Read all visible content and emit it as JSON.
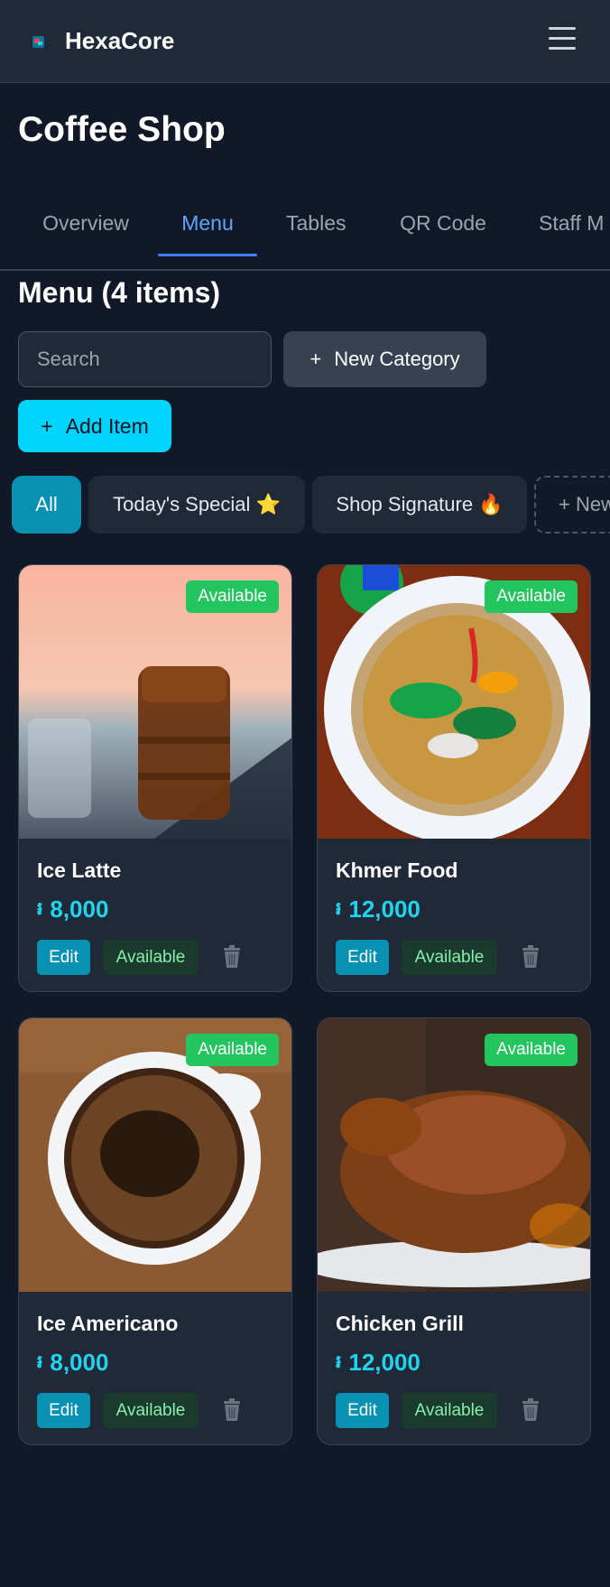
{
  "app": {
    "brand": "HexaCore",
    "logo_icon": "hexacore-logo-icon",
    "menu_icon": "hamburger-menu-icon"
  },
  "shop": {
    "title": "Coffee Shop"
  },
  "tabs": [
    {
      "label": "Overview",
      "active": false
    },
    {
      "label": "Menu",
      "active": true
    },
    {
      "label": "Tables",
      "active": false
    },
    {
      "label": "QR Code",
      "active": false
    },
    {
      "label": "Staff M",
      "active": false
    }
  ],
  "menu": {
    "heading": "Menu (4 items)",
    "search_placeholder": "Search",
    "new_category_label": "New Category",
    "add_item_label": "Add Item",
    "plus_glyph": "+"
  },
  "categories": [
    {
      "label": "All",
      "active": true
    },
    {
      "label": "Today's Special ⭐",
      "active": false
    },
    {
      "label": "Shop Signature 🔥",
      "active": false
    },
    {
      "label": "+ New",
      "active": false
    }
  ],
  "items": [
    {
      "name": "Ice Latte",
      "currency": "៛",
      "price": "8,000",
      "badge": "Available",
      "edit_label": "Edit",
      "status_label": "Available",
      "image": "iced-coffee-glass"
    },
    {
      "name": "Khmer Food",
      "currency": "៛",
      "price": "12,000",
      "badge": "Available",
      "edit_label": "Edit",
      "status_label": "Available",
      "image": "soup-bowl"
    },
    {
      "name": "Ice Americano",
      "currency": "៛",
      "price": "8,000",
      "badge": "Available",
      "edit_label": "Edit",
      "status_label": "Available",
      "image": "coffee-cup-top"
    },
    {
      "name": "Chicken Grill",
      "currency": "៛",
      "price": "12,000",
      "badge": "Available",
      "edit_label": "Edit",
      "status_label": "Available",
      "image": "roast-chicken"
    }
  ],
  "colors": {
    "accent": "#00d4ff",
    "active_tab": "#60a5fa",
    "available": "#22c55e",
    "price": "#22d3ee",
    "background": "#111827",
    "card": "#1f2937"
  }
}
